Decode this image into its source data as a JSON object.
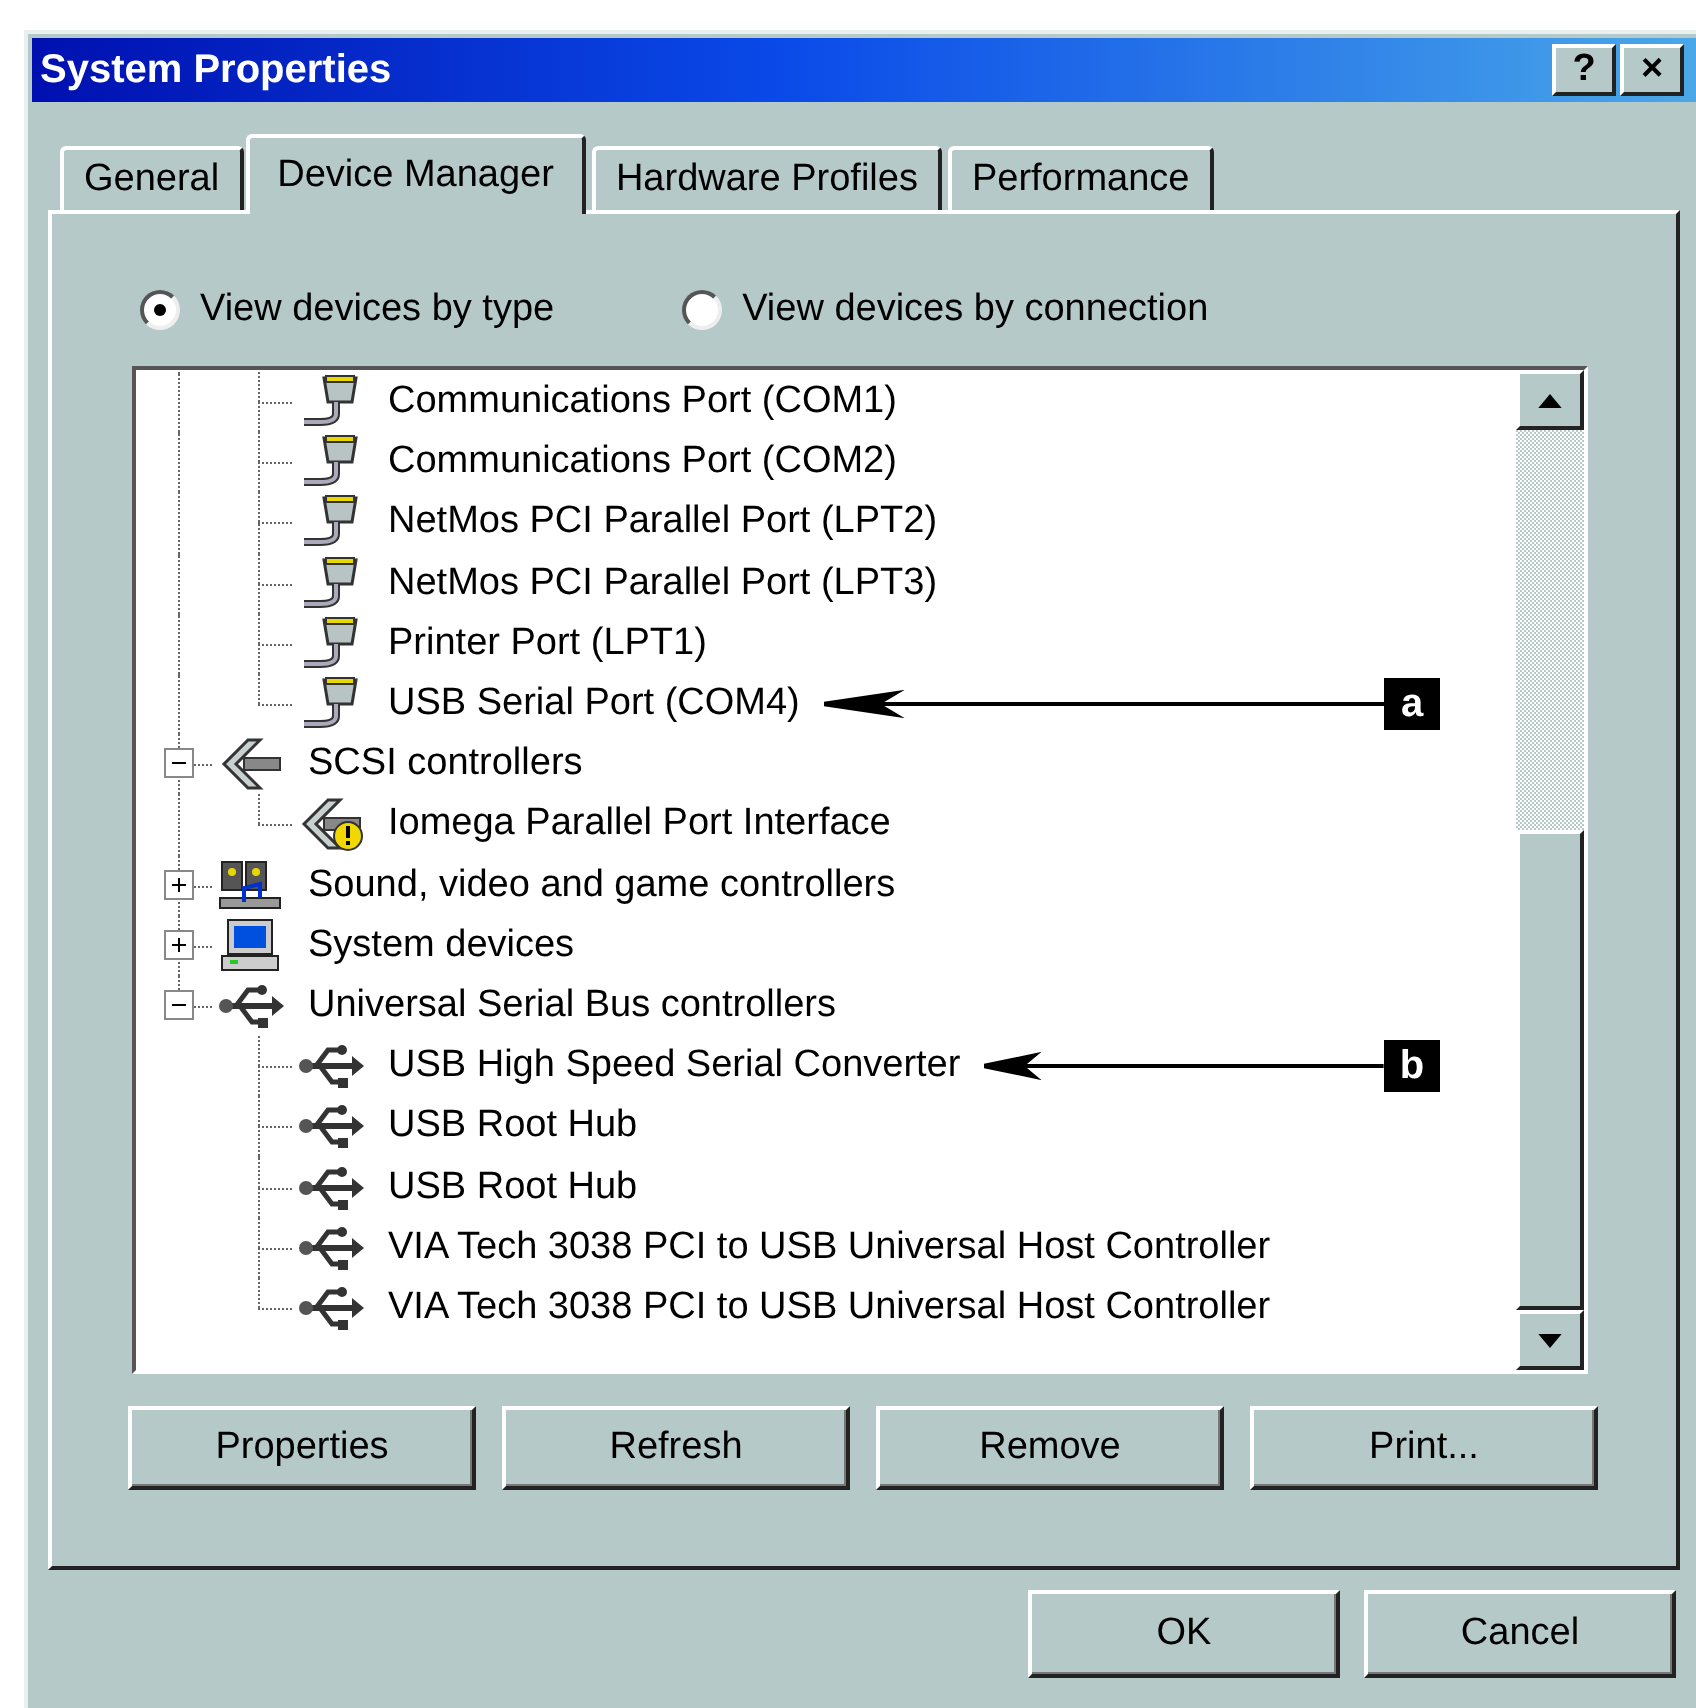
{
  "window": {
    "title": "System Properties",
    "title_buttons": [
      "?",
      "×"
    ]
  },
  "tabs": [
    {
      "label": "General",
      "selected": false
    },
    {
      "label": "Device Manager",
      "selected": true
    },
    {
      "label": "Hardware Profiles",
      "selected": false
    },
    {
      "label": "Performance",
      "selected": false
    }
  ],
  "view_options": [
    {
      "label": "View devices by type",
      "selected": true
    },
    {
      "label": "View devices by connection",
      "selected": false
    }
  ],
  "tree": [
    {
      "children": [
        {
          "label": "Communications Port (COM1)",
          "kind": "port"
        },
        {
          "label": "Communications Port (COM2)",
          "kind": "port"
        },
        {
          "label": "NetMos PCI Parallel Port (LPT2)",
          "kind": "port"
        },
        {
          "label": "NetMos PCI Parallel Port (LPT3)",
          "kind": "port"
        },
        {
          "label": "Printer Port (LPT1)",
          "kind": "port"
        },
        {
          "label": "USB Serial Port (COM4)",
          "kind": "port",
          "callout": "a"
        }
      ]
    },
    {
      "label": "SCSI controllers",
      "kind": "scsi",
      "expanded": true,
      "children": [
        {
          "label": "Iomega Parallel Port Interface",
          "kind": "scsi",
          "warning": true
        }
      ]
    },
    {
      "label": "Sound, video and game controllers",
      "kind": "sound",
      "expanded": false
    },
    {
      "label": "System devices",
      "kind": "system",
      "expanded": false
    },
    {
      "label": "Universal Serial Bus controllers",
      "kind": "usb",
      "expanded": true,
      "children": [
        {
          "label": "USB High Speed Serial Converter",
          "kind": "usb",
          "callout": "b"
        },
        {
          "label": "USB Root Hub",
          "kind": "usb"
        },
        {
          "label": "USB Root Hub",
          "kind": "usb"
        },
        {
          "label": "VIA Tech 3038 PCI to USB Universal Host Controller",
          "kind": "usb"
        },
        {
          "label": "VIA Tech 3038 PCI to USB Universal Host Controller",
          "kind": "usb"
        }
      ]
    }
  ],
  "tree_buttons": [
    "Properties",
    "Refresh",
    "Remove",
    "Print..."
  ],
  "dialog_buttons": [
    "OK",
    "Cancel"
  ]
}
